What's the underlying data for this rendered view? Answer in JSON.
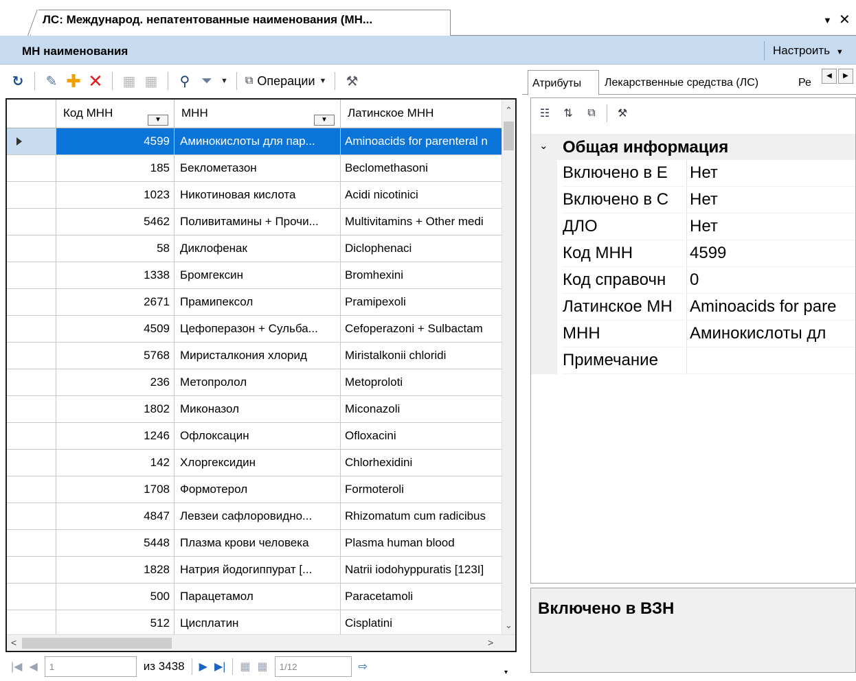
{
  "document_tab": {
    "title": "ЛС: Международ. непатентованные наименования (МН...",
    "menu_icon": "dropdown-arrow",
    "close_icon": "close-x"
  },
  "panel": {
    "title": "МН наименования",
    "configure_label": "Настроить"
  },
  "toolbar": {
    "operations_label": "Операции",
    "icons": [
      "refresh",
      "edit",
      "add",
      "delete",
      "save-disabled",
      "save-all-disabled",
      "find",
      "filter",
      "operations",
      "settings"
    ]
  },
  "grid": {
    "columns": [
      "Код МНН",
      "МНН",
      "Латинское МНН"
    ],
    "rows": [
      {
        "code": "4599",
        "name": "Аминокислоты для пар...",
        "latin": "Aminoacids for parenteral n",
        "selected": true
      },
      {
        "code": "185",
        "name": "Беклометазон",
        "latin": "Beclomethasoni",
        "selected": false
      },
      {
        "code": "1023",
        "name": "Никотиновая кислота",
        "latin": "Acidi nicotinici",
        "selected": false
      },
      {
        "code": "5462",
        "name": "Поливитамины + Прочи...",
        "latin": "Multivitamins + Other medi",
        "selected": false
      },
      {
        "code": "58",
        "name": "Диклофенак",
        "latin": "Diclophenaci",
        "selected": false
      },
      {
        "code": "1338",
        "name": "Бромгексин",
        "latin": "Bromhexini",
        "selected": false
      },
      {
        "code": "2671",
        "name": "Прамипексол",
        "latin": "Pramipexoli",
        "selected": false
      },
      {
        "code": "4509",
        "name": "Цефоперазон + Сульба...",
        "latin": "Cefoperazoni + Sulbactam",
        "selected": false
      },
      {
        "code": "5768",
        "name": "Миристалкония хлорид",
        "latin": "Miristalkonii chloridi",
        "selected": false
      },
      {
        "code": "236",
        "name": "Метопролол",
        "latin": "Metoproloti",
        "selected": false
      },
      {
        "code": "1802",
        "name": "Миконазол",
        "latin": "Miconazoli",
        "selected": false
      },
      {
        "code": "1246",
        "name": "Офлоксацин",
        "latin": "Ofloxacini",
        "selected": false
      },
      {
        "code": "142",
        "name": "Хлоргексидин",
        "latin": "Chlorhexidini",
        "selected": false
      },
      {
        "code": "1708",
        "name": "Формотерол",
        "latin": "Formoteroli",
        "selected": false
      },
      {
        "code": "4847",
        "name": "Левзеи сафлоровидно...",
        "latin": "Rhizomatum cum radicibus",
        "selected": false
      },
      {
        "code": "5448",
        "name": "Плазма крови человека",
        "latin": "Plasma human blood",
        "selected": false
      },
      {
        "code": "1828",
        "name": "Натрия йодогиппурат [...",
        "latin": "Natrii iodohyppuratis [123I]",
        "selected": false
      },
      {
        "code": "500",
        "name": "Парацетамол",
        "latin": "Paracetamoli",
        "selected": false
      },
      {
        "code": "512",
        "name": "Цисплатин",
        "latin": "Cisplatini",
        "selected": false
      }
    ]
  },
  "navigator": {
    "current_record": "1",
    "total_label": "из 3438",
    "page_value": "1/12"
  },
  "right_tabs": {
    "tabs": [
      "Атрибуты",
      "Лекарственные средства (ЛС)",
      "Ре"
    ],
    "active": "Атрибуты"
  },
  "properties": {
    "category": "Общая информация",
    "rows": [
      {
        "name": "Включено в Е",
        "value": "Нет"
      },
      {
        "name": "Включено в С",
        "value": "Нет"
      },
      {
        "name": "ДЛО",
        "value": "Нет"
      },
      {
        "name": "Код МНН",
        "value": "4599"
      },
      {
        "name": "Код справочн",
        "value": "0"
      },
      {
        "name": "Латинское МН",
        "value": "Aminoacids for pare"
      },
      {
        "name": "МНН",
        "value": "Аминокислоты дл"
      },
      {
        "name": "Примечание",
        "value": ""
      }
    ]
  },
  "description": {
    "title": "Включено в ВЗН"
  },
  "colors": {
    "header_band": "#c6daf0",
    "selection": "#0a74d9",
    "selection_indicator": "#c8dcf0"
  }
}
